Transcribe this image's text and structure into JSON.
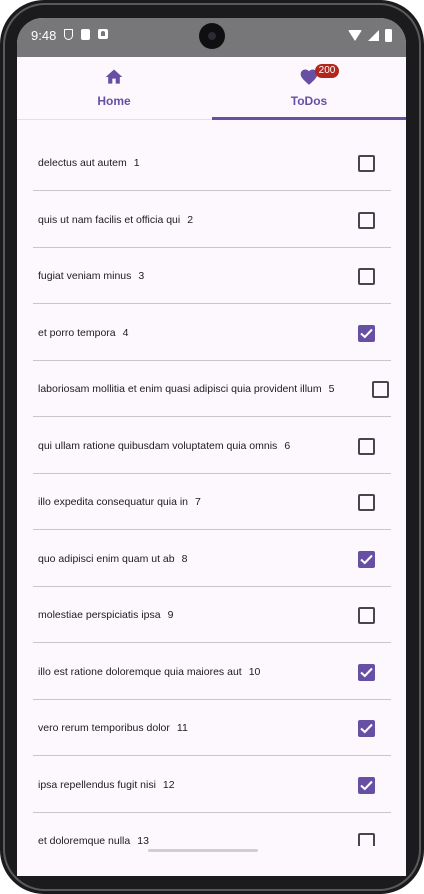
{
  "status_bar": {
    "time": "9:48",
    "icons": [
      "shield-icon",
      "sim-card-icon",
      "a-icon",
      "wifi-icon",
      "signal-icon",
      "battery-icon"
    ]
  },
  "tabs": [
    {
      "label": "Home",
      "icon": "home-icon",
      "selected": false
    },
    {
      "label": "ToDos",
      "icon": "heart-icon",
      "selected": true,
      "badge": "200"
    }
  ],
  "colors": {
    "accent": "#6750a4",
    "badge": "#b3261e",
    "background": "#fdf8fd"
  },
  "todos": [
    {
      "title": "delectus aut autem",
      "id": "1",
      "completed": false
    },
    {
      "title": "quis ut nam facilis et officia qui",
      "id": "2",
      "completed": false
    },
    {
      "title": "fugiat veniam minus",
      "id": "3",
      "completed": false
    },
    {
      "title": "et porro tempora",
      "id": "4",
      "completed": true
    },
    {
      "title": "laboriosam mollitia et enim quasi adipisci quia provident illum",
      "id": "5",
      "completed": false
    },
    {
      "title": "qui ullam ratione quibusdam voluptatem quia omnis",
      "id": "6",
      "completed": false
    },
    {
      "title": "illo expedita consequatur quia in",
      "id": "7",
      "completed": false
    },
    {
      "title": "quo adipisci enim quam ut ab",
      "id": "8",
      "completed": true
    },
    {
      "title": "molestiae perspiciatis ipsa",
      "id": "9",
      "completed": false
    },
    {
      "title": "illo est ratione doloremque quia maiores aut",
      "id": "10",
      "completed": true
    },
    {
      "title": "vero rerum temporibus dolor",
      "id": "11",
      "completed": true
    },
    {
      "title": "ipsa repellendus fugit nisi",
      "id": "12",
      "completed": true
    },
    {
      "title": "et doloremque nulla",
      "id": "13",
      "completed": false
    }
  ]
}
